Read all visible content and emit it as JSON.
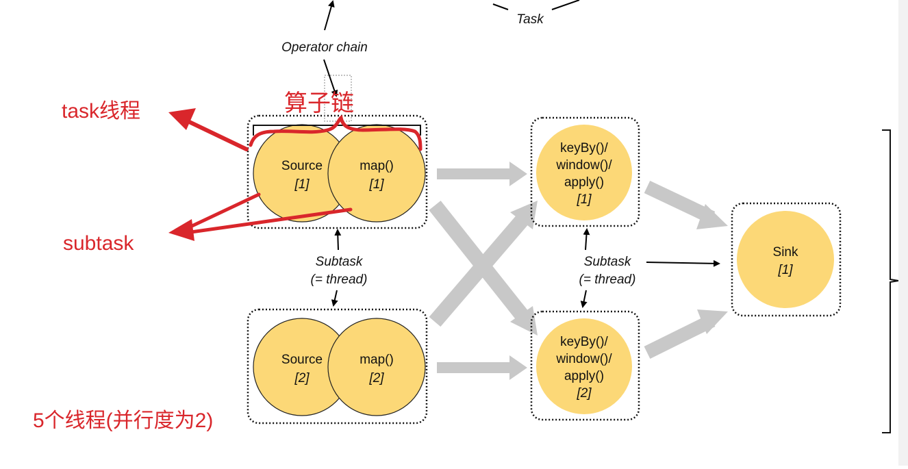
{
  "labels": {
    "task_top": "Task",
    "operator_chain": "Operator chain",
    "subtask_left_line1": "Subtask",
    "subtask_left_line2": "(= thread)",
    "subtask_right_line1": "Subtask",
    "subtask_right_line2": "(= thread)"
  },
  "nodes": {
    "source1": {
      "name": "Source",
      "index": "[1]"
    },
    "map1": {
      "name": "map()",
      "index": "[1]"
    },
    "source2": {
      "name": "Source",
      "index": "[2]"
    },
    "map2": {
      "name": "map()",
      "index": "[2]"
    },
    "keyby1": {
      "line1": "keyBy()/",
      "line2": "window()/",
      "line3": "apply()",
      "index": "[1]"
    },
    "keyby2": {
      "line1": "keyBy()/",
      "line2": "window()/",
      "line3": "apply()",
      "index": "[2]"
    },
    "sink": {
      "name": "Sink",
      "index": "[1]"
    }
  },
  "handwritten": {
    "operator_chain_cn": "算子链",
    "task_thread": "task线程",
    "subtask": "subtask",
    "five_threads": "5个线程(并行度为2)"
  },
  "colors": {
    "node_fill": "#fcd877",
    "edge_gray": "#c8c8c8",
    "annotation_red": "#d9262b"
  }
}
